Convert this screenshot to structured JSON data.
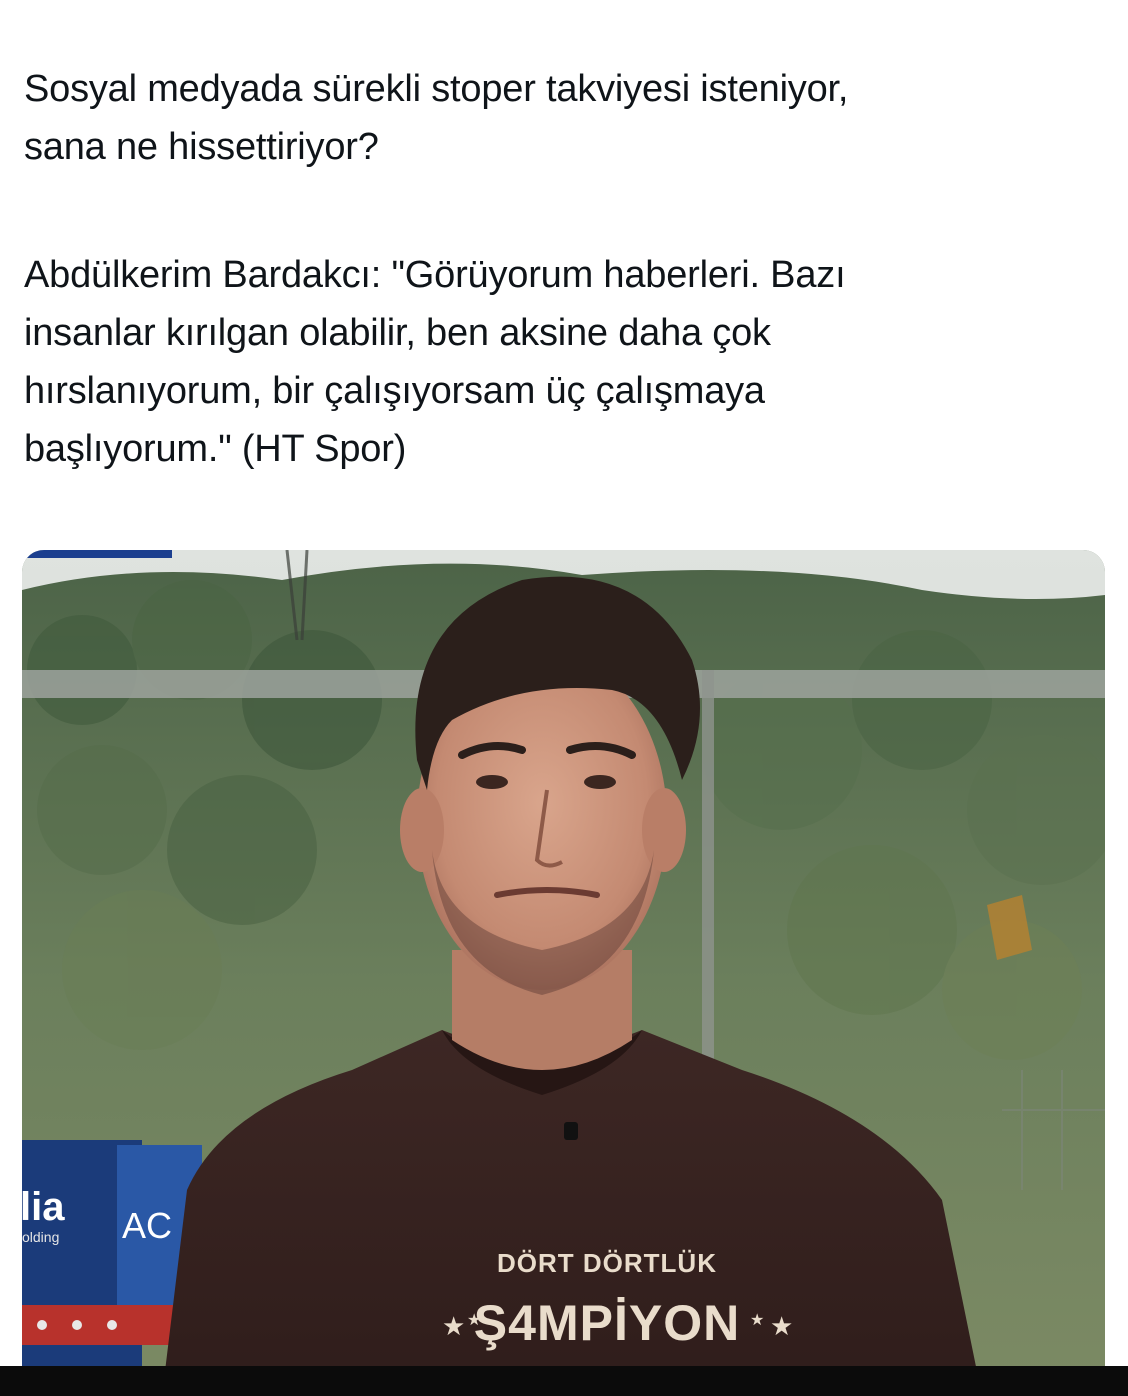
{
  "tweet": {
    "question_line1": "Sosyal medyada sürekli stoper takviyesi isteniyor,",
    "question_line2": "sana ne hissettiriyor?",
    "answer_line1": "Abdülkerim Bardakcı: \"Görüyorum haberleri. Bazı",
    "answer_line2": "insanlar kırılgan olabilir, ben aksine daha çok",
    "answer_line3": "hırslanıyorum, bir çalışıyorsam üç çalışmaya",
    "answer_line4": "başlıyorum.\" (HT Spor)"
  },
  "media": {
    "sponsor_text_1": "lia",
    "sponsor_text_1_sub": "olding",
    "sponsor_text_2": "AC",
    "shirt_text_line1": "DÖRT DÖRTLÜK",
    "shirt_text_line2": "Ş4MPİYON"
  },
  "colors": {
    "text": "#0f1419",
    "shirt": "#3a2522",
    "shirt_print": "#e9dccb",
    "hill_green": "#5e7454",
    "sky": "#d7dcd8"
  }
}
